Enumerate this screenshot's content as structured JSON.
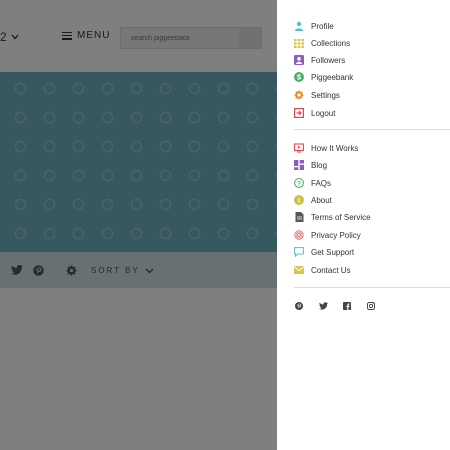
{
  "background": {
    "header": {
      "dropdown_value": "2",
      "menu_label": "MENU",
      "search_placeholder": "search piggeeback"
    },
    "toolbar": {
      "sort_label": "SORT BY"
    }
  },
  "side_menu": {
    "account_items": [
      {
        "label": "Profile",
        "icon": "person-icon",
        "color": "#4fc3c8"
      },
      {
        "label": "Collections",
        "icon": "grid-icon",
        "color": "#d4c94a"
      },
      {
        "label": "Followers",
        "icon": "followers-icon",
        "color": "#8b5fbf"
      },
      {
        "label": "Piggeebank",
        "icon": "dollar-icon",
        "color": "#4caf6a"
      },
      {
        "label": "Settings",
        "icon": "gear-icon",
        "color": "#f08a24"
      },
      {
        "label": "Logout",
        "icon": "logout-icon",
        "color": "#e04a4a"
      }
    ],
    "info_items": [
      {
        "label": "How It Works",
        "icon": "tv-icon",
        "color": "#e04a4a"
      },
      {
        "label": "Blog",
        "icon": "blog-icon",
        "color": "#8b5fbf"
      },
      {
        "label": "FAQs",
        "icon": "question-icon",
        "color": "#4caf6a"
      },
      {
        "label": "About",
        "icon": "info-icon",
        "color": "#c9c24a"
      },
      {
        "label": "Terms of Service",
        "icon": "document-icon",
        "color": "#555555"
      },
      {
        "label": "Privacy Policy",
        "icon": "fingerprint-icon",
        "color": "#e0707a"
      },
      {
        "label": "Get Support",
        "icon": "chat-icon",
        "color": "#4fc3c8"
      },
      {
        "label": "Contact Us",
        "icon": "envelope-icon",
        "color": "#d4c94a"
      }
    ],
    "social": [
      {
        "icon": "pinterest-icon"
      },
      {
        "icon": "twitter-icon"
      },
      {
        "icon": "facebook-icon"
      },
      {
        "icon": "instagram-icon"
      }
    ]
  }
}
